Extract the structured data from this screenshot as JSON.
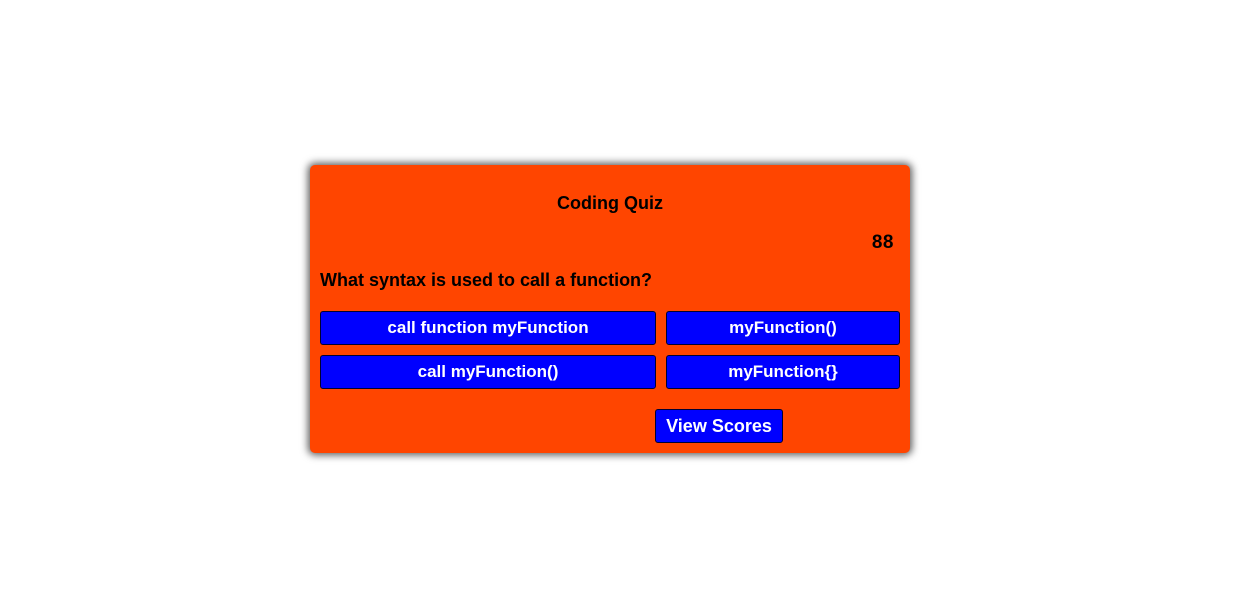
{
  "quiz": {
    "title": "Coding Quiz",
    "timer": "88",
    "question": "What syntax is used to call a function?",
    "answers": [
      "call function myFunction",
      "myFunction()",
      "call myFunction()",
      "myFunction{}"
    ],
    "view_scores_label": "View Scores"
  },
  "colors": {
    "card_background": "#ff4500",
    "button_background": "#0000ff",
    "button_text": "#ffffff",
    "page_background": "#ffffff"
  }
}
